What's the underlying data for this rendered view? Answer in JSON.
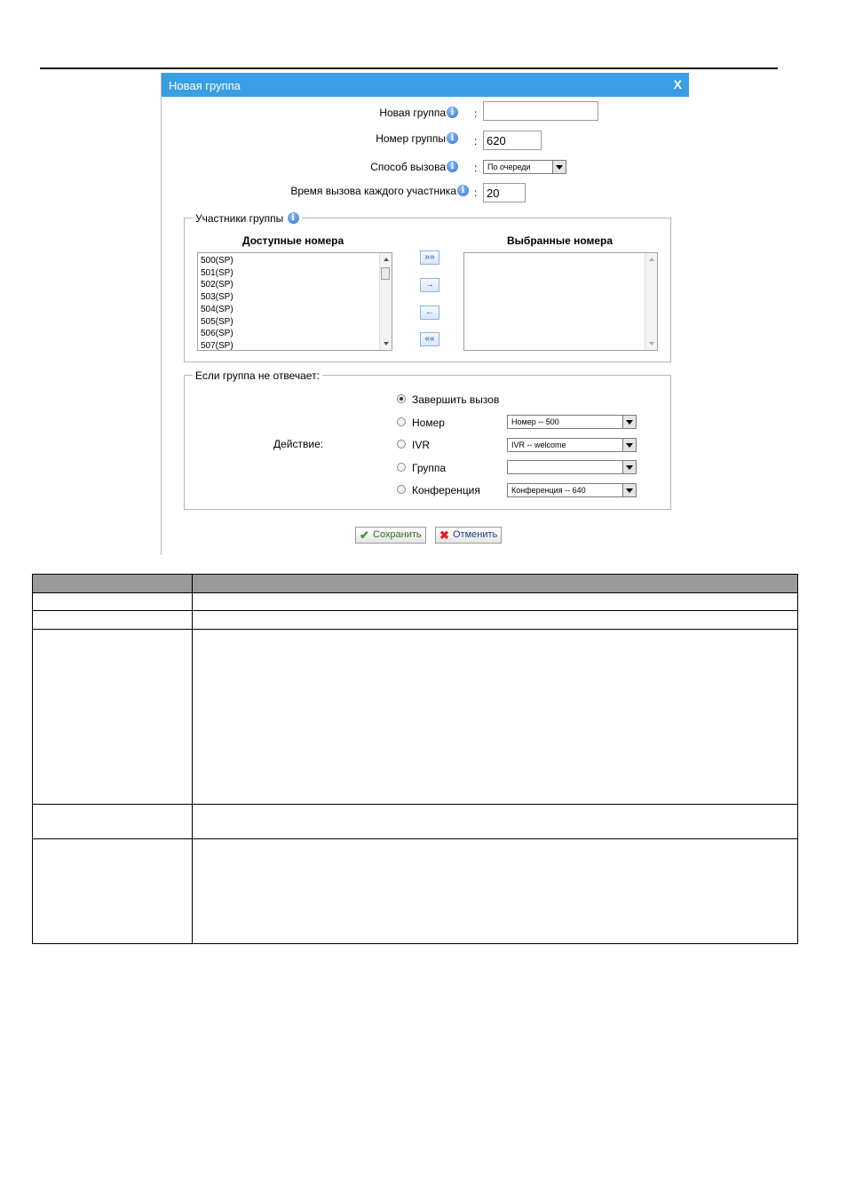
{
  "dialog": {
    "title": "Новая группа",
    "close": "X",
    "fields": {
      "group_name": {
        "label": "Новая группа",
        "value": ""
      },
      "group_number": {
        "label": "Номер группы",
        "value": "620"
      },
      "call_method": {
        "label": "Способ вызова",
        "value": "По очереди"
      },
      "ring_time": {
        "label": "Время вызова каждого участника",
        "value": "20"
      },
      "colon": ":"
    },
    "members": {
      "legend": "Участники группы",
      "available_header": "Доступные номера",
      "selected_header": "Выбранные номера",
      "available": [
        "500(SP)",
        "501(SP)",
        "502(SP)",
        "503(SP)",
        "504(SP)",
        "505(SP)",
        "506(SP)",
        "507(SP)"
      ],
      "selected": [],
      "buttons": {
        "add_all": "»»",
        "add": "→",
        "remove": "←",
        "remove_all": "««"
      }
    },
    "no_answer": {
      "legend": "Если группа не отвечает:",
      "action_label": "Действие:",
      "options": [
        {
          "label": "Завершить вызов",
          "checked": true
        },
        {
          "label": "Номер",
          "checked": false,
          "select": "Номер -- 500"
        },
        {
          "label": "IVR",
          "checked": false,
          "select": "IVR -- welcome"
        },
        {
          "label": "Группа",
          "checked": false,
          "select": ""
        },
        {
          "label": "Конференция",
          "checked": false,
          "select": "Конференция -- 640"
        }
      ]
    },
    "save": "Сохранить",
    "cancel": "Отменить"
  },
  "icons": {
    "info": "info-icon",
    "save": "checkmark-icon",
    "cancel": "x-icon"
  },
  "colors": {
    "titlebar": "#3a9ee4",
    "table_header": "#9a9a9a"
  }
}
